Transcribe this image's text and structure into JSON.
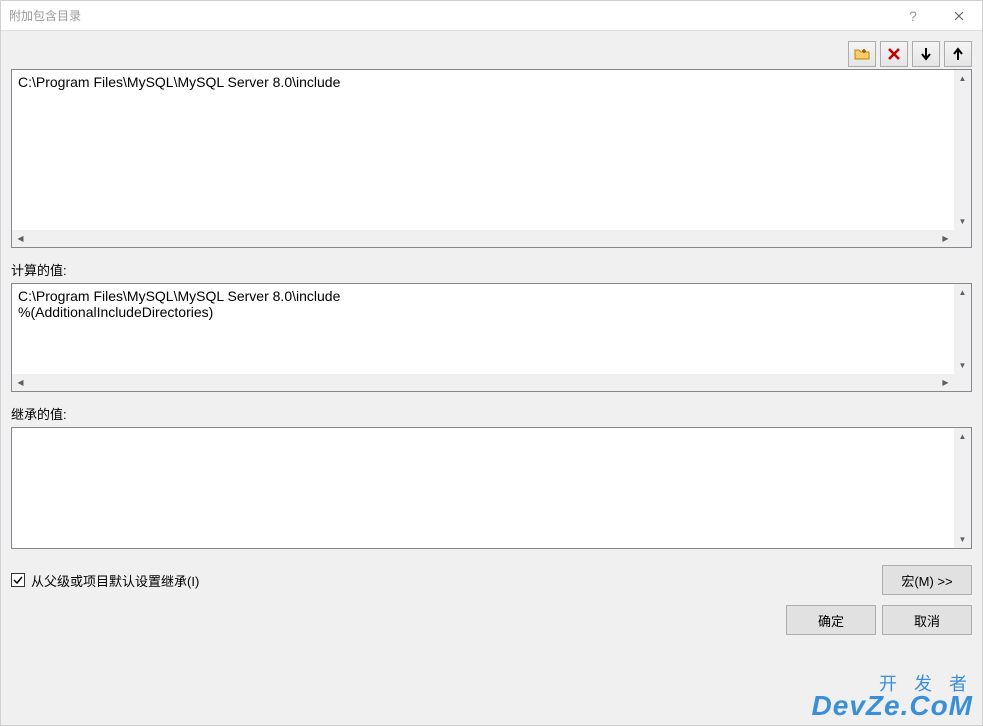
{
  "window": {
    "title": "附加包含目录"
  },
  "toolbar": {
    "folder_icon": "folder-icon",
    "delete_icon": "delete-icon",
    "down_icon": "down-arrow-icon",
    "up_icon": "up-arrow-icon"
  },
  "edit": {
    "content": "C:\\Program Files\\MySQL\\MySQL Server 8.0\\include"
  },
  "computed": {
    "label": "计算的值:",
    "content": "C:\\Program Files\\MySQL\\MySQL Server 8.0\\include\n%(AdditionalIncludeDirectories)"
  },
  "inherited": {
    "label": "继承的值:",
    "content": ""
  },
  "inherit_checkbox": {
    "label": "从父级或项目默认设置继承(I)",
    "checked": true
  },
  "buttons": {
    "macro": "宏(M) >>",
    "ok": "确定",
    "cancel": "取消"
  },
  "watermark": {
    "zh": "开 发 者",
    "en": "DevZe.CoM"
  }
}
